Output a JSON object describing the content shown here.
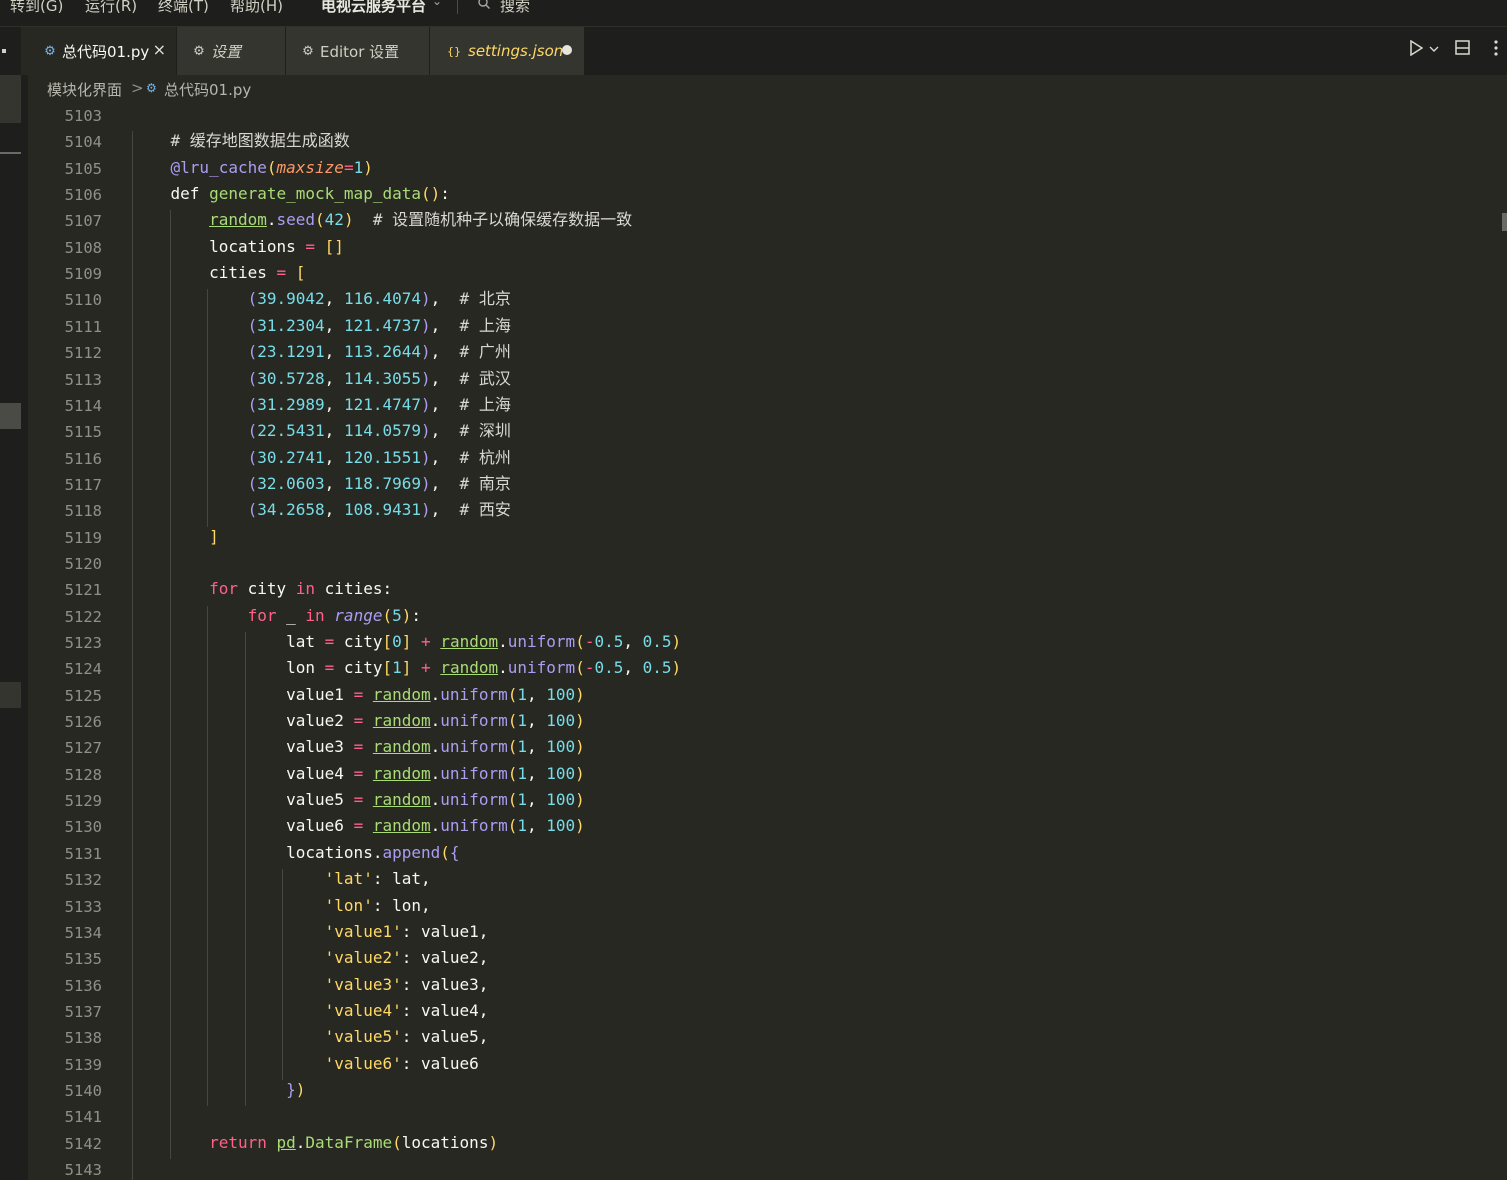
{
  "menubar": {
    "items": [
      "转到(G)",
      "运行(R)",
      "终端(T)",
      "帮助(H)"
    ],
    "window_title": "电视云服务平台",
    "search_placeholder": "搜索"
  },
  "tabs": [
    {
      "label": "总代码01.py",
      "icon": "python-file-icon",
      "active": true,
      "close": "×"
    },
    {
      "label": "设置",
      "icon": "gear-icon",
      "active": false
    },
    {
      "label": "Editor 设置",
      "icon": "gear-icon",
      "active": false
    },
    {
      "label": "settings.json",
      "icon": "json-braces-icon",
      "active": false,
      "dirty": true,
      "icon_text": "{}"
    }
  ],
  "toolbar": {
    "run_icon": "play-icon",
    "split_icon": "split-editor-icon",
    "more_icon": "more-icon"
  },
  "breadcrumb": {
    "folder": "模块化界面",
    "separator": ">",
    "file": "总代码01.py"
  },
  "editor": {
    "line_numbers": [
      "5103",
      "5104",
      "5105",
      "5106",
      "5107",
      "5108",
      "5109",
      "5110",
      "5111",
      "5112",
      "5113",
      "5114",
      "5115",
      "5116",
      "5117",
      "5118",
      "5119",
      "5120",
      "5121",
      "5122",
      "5123",
      "5124",
      "5125",
      "5126",
      "5127",
      "5128",
      "5129",
      "5130",
      "5131",
      "5132",
      "5133",
      "5134",
      "5135",
      "5136",
      "5137",
      "5138",
      "5139",
      "5140",
      "5141",
      "5142",
      "5143"
    ],
    "lines": [
      [],
      [
        [
          "    ",
          "t"
        ],
        [
          "# 缓存地图数据生成函数",
          "com"
        ]
      ],
      [
        [
          "    ",
          "t"
        ],
        [
          "@lru_cache",
          "dec"
        ],
        [
          "(",
          "b1"
        ],
        [
          "maxsize",
          "param"
        ],
        [
          "=",
          "op"
        ],
        [
          "1",
          "num"
        ],
        [
          ")",
          "b1"
        ]
      ],
      [
        [
          "    ",
          "t"
        ],
        [
          "def ",
          "def"
        ],
        [
          "generate_mock_map_data",
          "fn"
        ],
        [
          "()",
          "b1"
        ],
        [
          ":",
          "t"
        ]
      ],
      [
        [
          "        ",
          "t"
        ],
        [
          "random",
          "mod"
        ],
        [
          ".",
          "t"
        ],
        [
          "seed",
          "meth"
        ],
        [
          "(",
          "b1"
        ],
        [
          "42",
          "num"
        ],
        [
          ")",
          "b1"
        ],
        [
          "  # 设置随机种子以确保缓存数据一致",
          "com"
        ]
      ],
      [
        [
          "        ",
          "t"
        ],
        [
          "locations ",
          "t"
        ],
        [
          "=",
          "op"
        ],
        [
          " ",
          "t"
        ],
        [
          "[]",
          "b1"
        ]
      ],
      [
        [
          "        ",
          "t"
        ],
        [
          "cities ",
          "t"
        ],
        [
          "=",
          "op"
        ],
        [
          " ",
          "t"
        ],
        [
          "[",
          "b1"
        ]
      ],
      [
        [
          "            ",
          "t"
        ],
        [
          "(",
          "b2"
        ],
        [
          "39.9042",
          "num"
        ],
        [
          ", ",
          "t"
        ],
        [
          "116.4074",
          "num"
        ],
        [
          ")",
          "b2"
        ],
        [
          ",  ",
          "t"
        ],
        [
          "# 北京",
          "com"
        ]
      ],
      [
        [
          "            ",
          "t"
        ],
        [
          "(",
          "b2"
        ],
        [
          "31.2304",
          "num"
        ],
        [
          ", ",
          "t"
        ],
        [
          "121.4737",
          "num"
        ],
        [
          ")",
          "b2"
        ],
        [
          ",  ",
          "t"
        ],
        [
          "# 上海",
          "com"
        ]
      ],
      [
        [
          "            ",
          "t"
        ],
        [
          "(",
          "b2"
        ],
        [
          "23.1291",
          "num"
        ],
        [
          ", ",
          "t"
        ],
        [
          "113.2644",
          "num"
        ],
        [
          ")",
          "b2"
        ],
        [
          ",  ",
          "t"
        ],
        [
          "# 广州",
          "com"
        ]
      ],
      [
        [
          "            ",
          "t"
        ],
        [
          "(",
          "b2"
        ],
        [
          "30.5728",
          "num"
        ],
        [
          ", ",
          "t"
        ],
        [
          "114.3055",
          "num"
        ],
        [
          ")",
          "b2"
        ],
        [
          ",  ",
          "t"
        ],
        [
          "# 武汉",
          "com"
        ]
      ],
      [
        [
          "            ",
          "t"
        ],
        [
          "(",
          "b2"
        ],
        [
          "31.2989",
          "num"
        ],
        [
          ", ",
          "t"
        ],
        [
          "121.4747",
          "num"
        ],
        [
          ")",
          "b2"
        ],
        [
          ",  ",
          "t"
        ],
        [
          "# 上海",
          "com"
        ]
      ],
      [
        [
          "            ",
          "t"
        ],
        [
          "(",
          "b2"
        ],
        [
          "22.5431",
          "num"
        ],
        [
          ", ",
          "t"
        ],
        [
          "114.0579",
          "num"
        ],
        [
          ")",
          "b2"
        ],
        [
          ",  ",
          "t"
        ],
        [
          "# 深圳",
          "com"
        ]
      ],
      [
        [
          "            ",
          "t"
        ],
        [
          "(",
          "b2"
        ],
        [
          "30.2741",
          "num"
        ],
        [
          ", ",
          "t"
        ],
        [
          "120.1551",
          "num"
        ],
        [
          ")",
          "b2"
        ],
        [
          ",  ",
          "t"
        ],
        [
          "# 杭州",
          "com"
        ]
      ],
      [
        [
          "            ",
          "t"
        ],
        [
          "(",
          "b2"
        ],
        [
          "32.0603",
          "num"
        ],
        [
          ", ",
          "t"
        ],
        [
          "118.7969",
          "num"
        ],
        [
          ")",
          "b2"
        ],
        [
          ",  ",
          "t"
        ],
        [
          "# 南京",
          "com"
        ]
      ],
      [
        [
          "            ",
          "t"
        ],
        [
          "(",
          "b2"
        ],
        [
          "34.2658",
          "num"
        ],
        [
          ", ",
          "t"
        ],
        [
          "108.9431",
          "num"
        ],
        [
          ")",
          "b2"
        ],
        [
          ",  ",
          "t"
        ],
        [
          "# 西安",
          "com"
        ]
      ],
      [
        [
          "        ",
          "t"
        ],
        [
          "]",
          "b1"
        ]
      ],
      [],
      [
        [
          "        ",
          "t"
        ],
        [
          "for ",
          "kw"
        ],
        [
          "city ",
          "t"
        ],
        [
          "in ",
          "kw"
        ],
        [
          "cities:",
          "t"
        ]
      ],
      [
        [
          "            ",
          "t"
        ],
        [
          "for ",
          "kw"
        ],
        [
          "_ ",
          "t"
        ],
        [
          "in ",
          "kw"
        ],
        [
          "range",
          "builtin"
        ],
        [
          "(",
          "b1"
        ],
        [
          "5",
          "num"
        ],
        [
          ")",
          "b1"
        ],
        [
          ":",
          "t"
        ]
      ],
      [
        [
          "                ",
          "t"
        ],
        [
          "lat ",
          "t"
        ],
        [
          "=",
          "op"
        ],
        [
          " city",
          "t"
        ],
        [
          "[",
          "b1"
        ],
        [
          "0",
          "num"
        ],
        [
          "]",
          "b1"
        ],
        [
          " ",
          "t"
        ],
        [
          "+",
          "op"
        ],
        [
          " ",
          "t"
        ],
        [
          "random",
          "mod"
        ],
        [
          ".",
          "t"
        ],
        [
          "uniform",
          "meth"
        ],
        [
          "(",
          "b1"
        ],
        [
          "-",
          "op"
        ],
        [
          "0.5",
          "num"
        ],
        [
          ", ",
          "t"
        ],
        [
          "0.5",
          "num"
        ],
        [
          ")",
          "b1"
        ]
      ],
      [
        [
          "                ",
          "t"
        ],
        [
          "lon ",
          "t"
        ],
        [
          "=",
          "op"
        ],
        [
          " city",
          "t"
        ],
        [
          "[",
          "b1"
        ],
        [
          "1",
          "num"
        ],
        [
          "]",
          "b1"
        ],
        [
          " ",
          "t"
        ],
        [
          "+",
          "op"
        ],
        [
          " ",
          "t"
        ],
        [
          "random",
          "mod"
        ],
        [
          ".",
          "t"
        ],
        [
          "uniform",
          "meth"
        ],
        [
          "(",
          "b1"
        ],
        [
          "-",
          "op"
        ],
        [
          "0.5",
          "num"
        ],
        [
          ", ",
          "t"
        ],
        [
          "0.5",
          "num"
        ],
        [
          ")",
          "b1"
        ]
      ],
      [
        [
          "                ",
          "t"
        ],
        [
          "value1 ",
          "t"
        ],
        [
          "=",
          "op"
        ],
        [
          " ",
          "t"
        ],
        [
          "random",
          "mod"
        ],
        [
          ".",
          "t"
        ],
        [
          "uniform",
          "meth"
        ],
        [
          "(",
          "b1"
        ],
        [
          "1",
          "num"
        ],
        [
          ", ",
          "t"
        ],
        [
          "100",
          "num"
        ],
        [
          ")",
          "b1"
        ]
      ],
      [
        [
          "                ",
          "t"
        ],
        [
          "value2 ",
          "t"
        ],
        [
          "=",
          "op"
        ],
        [
          " ",
          "t"
        ],
        [
          "random",
          "mod"
        ],
        [
          ".",
          "t"
        ],
        [
          "uniform",
          "meth"
        ],
        [
          "(",
          "b1"
        ],
        [
          "1",
          "num"
        ],
        [
          ", ",
          "t"
        ],
        [
          "100",
          "num"
        ],
        [
          ")",
          "b1"
        ]
      ],
      [
        [
          "                ",
          "t"
        ],
        [
          "value3 ",
          "t"
        ],
        [
          "=",
          "op"
        ],
        [
          " ",
          "t"
        ],
        [
          "random",
          "mod"
        ],
        [
          ".",
          "t"
        ],
        [
          "uniform",
          "meth"
        ],
        [
          "(",
          "b1"
        ],
        [
          "1",
          "num"
        ],
        [
          ", ",
          "t"
        ],
        [
          "100",
          "num"
        ],
        [
          ")",
          "b1"
        ]
      ],
      [
        [
          "                ",
          "t"
        ],
        [
          "value4 ",
          "t"
        ],
        [
          "=",
          "op"
        ],
        [
          " ",
          "t"
        ],
        [
          "random",
          "mod"
        ],
        [
          ".",
          "t"
        ],
        [
          "uniform",
          "meth"
        ],
        [
          "(",
          "b1"
        ],
        [
          "1",
          "num"
        ],
        [
          ", ",
          "t"
        ],
        [
          "100",
          "num"
        ],
        [
          ")",
          "b1"
        ]
      ],
      [
        [
          "                ",
          "t"
        ],
        [
          "value5 ",
          "t"
        ],
        [
          "=",
          "op"
        ],
        [
          " ",
          "t"
        ],
        [
          "random",
          "mod"
        ],
        [
          ".",
          "t"
        ],
        [
          "uniform",
          "meth"
        ],
        [
          "(",
          "b1"
        ],
        [
          "1",
          "num"
        ],
        [
          ", ",
          "t"
        ],
        [
          "100",
          "num"
        ],
        [
          ")",
          "b1"
        ]
      ],
      [
        [
          "                ",
          "t"
        ],
        [
          "value6 ",
          "t"
        ],
        [
          "=",
          "op"
        ],
        [
          " ",
          "t"
        ],
        [
          "random",
          "mod"
        ],
        [
          ".",
          "t"
        ],
        [
          "uniform",
          "meth"
        ],
        [
          "(",
          "b1"
        ],
        [
          "1",
          "num"
        ],
        [
          ", ",
          "t"
        ],
        [
          "100",
          "num"
        ],
        [
          ")",
          "b1"
        ]
      ],
      [
        [
          "                ",
          "t"
        ],
        [
          "locations",
          "t"
        ],
        [
          ".",
          "t"
        ],
        [
          "append",
          "meth"
        ],
        [
          "(",
          "b1"
        ],
        [
          "{",
          "b2"
        ]
      ],
      [
        [
          "                    ",
          "t"
        ],
        [
          "'lat'",
          "str"
        ],
        [
          ": lat,",
          "t"
        ]
      ],
      [
        [
          "                    ",
          "t"
        ],
        [
          "'lon'",
          "str"
        ],
        [
          ": lon,",
          "t"
        ]
      ],
      [
        [
          "                    ",
          "t"
        ],
        [
          "'value1'",
          "str"
        ],
        [
          ": value1,",
          "t"
        ]
      ],
      [
        [
          "                    ",
          "t"
        ],
        [
          "'value2'",
          "str"
        ],
        [
          ": value2,",
          "t"
        ]
      ],
      [
        [
          "                    ",
          "t"
        ],
        [
          "'value3'",
          "str"
        ],
        [
          ": value3,",
          "t"
        ]
      ],
      [
        [
          "                    ",
          "t"
        ],
        [
          "'value4'",
          "str"
        ],
        [
          ": value4,",
          "t"
        ]
      ],
      [
        [
          "                    ",
          "t"
        ],
        [
          "'value5'",
          "str"
        ],
        [
          ": value5,",
          "t"
        ]
      ],
      [
        [
          "                    ",
          "t"
        ],
        [
          "'value6'",
          "str"
        ],
        [
          ": value6",
          "t"
        ]
      ],
      [
        [
          "                ",
          "t"
        ],
        [
          "}",
          "b2"
        ],
        [
          ")",
          "b1"
        ]
      ],
      [],
      [
        [
          "        ",
          "t"
        ],
        [
          "return ",
          "kw"
        ],
        [
          "pd",
          "mod"
        ],
        [
          ".",
          "t"
        ],
        [
          "DataFrame",
          "fn"
        ],
        [
          "(",
          "b1"
        ],
        [
          "locations",
          "t"
        ],
        [
          ")",
          "b1"
        ]
      ],
      []
    ]
  }
}
